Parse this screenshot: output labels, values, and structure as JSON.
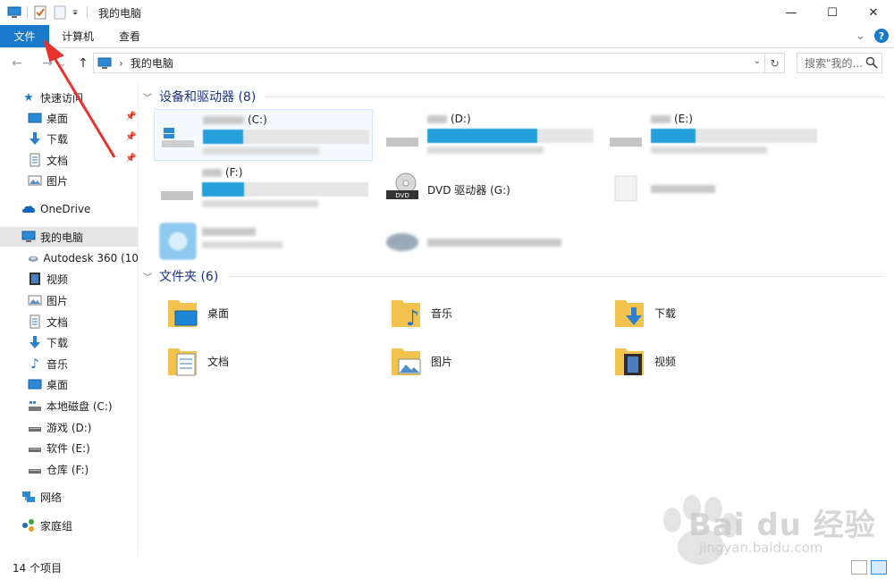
{
  "window": {
    "title": "我的电脑",
    "minimize": "—",
    "maximize": "☐",
    "close": "✕"
  },
  "ribbon": {
    "tabs": [
      {
        "label": "文件",
        "active": true
      },
      {
        "label": "计算机"
      },
      {
        "label": "查看"
      }
    ],
    "expand": "⌄",
    "help": "?"
  },
  "address": {
    "back": "←",
    "forward": "→",
    "recent": "⌄",
    "up": "↑",
    "path": "我的电脑",
    "separator": "›",
    "dropdown": "⌄",
    "refresh": "↻"
  },
  "search": {
    "placeholder": "搜索\"我的...",
    "icon": "search-icon"
  },
  "nav": {
    "quick_access": "快速访问",
    "quick_items": [
      {
        "label": "桌面",
        "icon": "desktop-icon",
        "pinned": true
      },
      {
        "label": "下载",
        "icon": "download-icon",
        "pinned": true
      },
      {
        "label": "文档",
        "icon": "document-icon",
        "pinned": true
      },
      {
        "label": "图片",
        "icon": "picture-icon",
        "pinned": false
      }
    ],
    "onedrive": "OneDrive",
    "this_pc": "我的电脑",
    "pc_items": [
      {
        "label": "Autodesk 360 (10",
        "icon": "cloud-drive-icon"
      },
      {
        "label": "视频",
        "icon": "video-icon"
      },
      {
        "label": "图片",
        "icon": "picture-icon"
      },
      {
        "label": "文档",
        "icon": "document-icon"
      },
      {
        "label": "下载",
        "icon": "download-icon"
      },
      {
        "label": "音乐",
        "icon": "music-icon"
      },
      {
        "label": "桌面",
        "icon": "desktop-icon"
      },
      {
        "label": "本地磁盘 (C:)",
        "icon": "system-drive-icon"
      },
      {
        "label": "游戏 (D:)",
        "icon": "drive-icon"
      },
      {
        "label": "软件 (E:)",
        "icon": "drive-icon"
      },
      {
        "label": "仓库 (F:)",
        "icon": "drive-icon"
      }
    ],
    "network": "网络",
    "homegroup": "家庭组"
  },
  "groups": {
    "drives_header": "设备和驱动器 (8)",
    "folders_header": "文件夹 (6)"
  },
  "drives": [
    {
      "letter": "(C:)",
      "used_fraction": 0.24
    },
    {
      "letter": "(D:)",
      "used_fraction": 0.66
    },
    {
      "letter": "(E:)",
      "used_fraction": 0.27
    },
    {
      "letter": "(F:)",
      "used_fraction": 0.25
    }
  ],
  "dvd": {
    "label": "DVD 驱动器 (G:)",
    "badge": "DVD"
  },
  "folders": [
    {
      "label": "桌面",
      "icon": "desktop-folder-icon"
    },
    {
      "label": "音乐",
      "icon": "music-folder-icon"
    },
    {
      "label": "下载",
      "icon": "download-folder-icon"
    },
    {
      "label": "文档",
      "icon": "documents-folder-icon"
    },
    {
      "label": "图片",
      "icon": "pictures-folder-icon"
    },
    {
      "label": "视频",
      "icon": "videos-folder-icon"
    }
  ],
  "status": {
    "count": "14 个项目"
  },
  "colors": {
    "accent": "#1979ca",
    "drive_bar": "#26a0da",
    "group_header": "#1e3287",
    "annotation": "#e8322d"
  },
  "watermark": {
    "text": "Bai du 经验",
    "sub": "jingyan.baidu.com"
  }
}
